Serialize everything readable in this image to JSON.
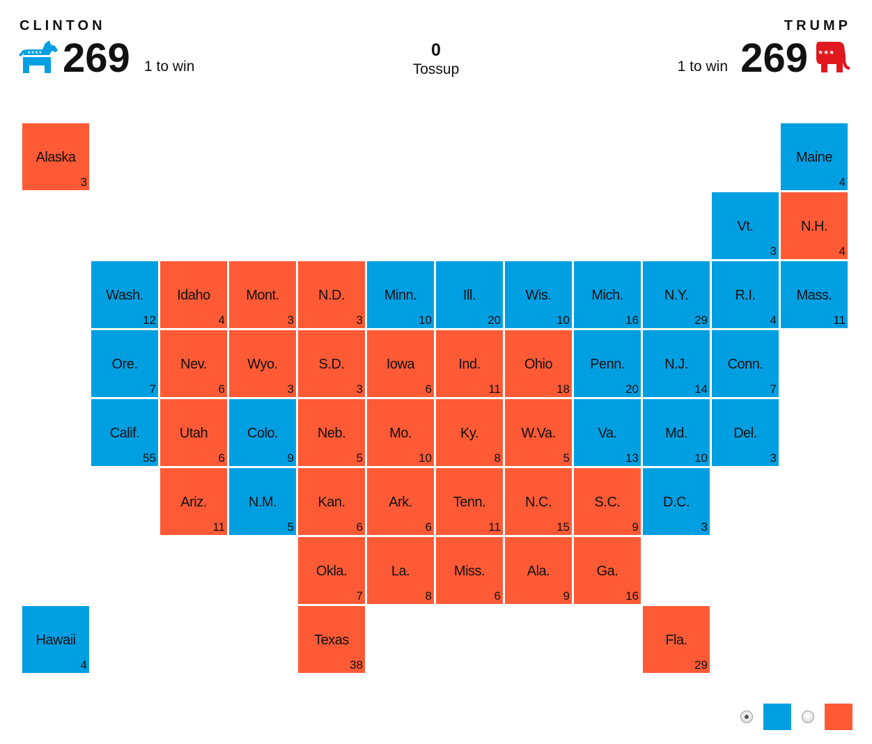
{
  "header": {
    "left": {
      "name": "CLINTON",
      "score": "269",
      "to_win": "1 to win",
      "icon": "democrat-donkey-icon"
    },
    "right": {
      "name": "TRUMP",
      "score": "269",
      "to_win": "1 to win",
      "icon": "republican-elephant-icon"
    },
    "tossup": {
      "count": "0",
      "label": "Tossup"
    }
  },
  "colors": {
    "dem": "#009fe2",
    "rep": "#ff5a36",
    "text": "#111111"
  },
  "legend": {
    "items": [
      {
        "party": "dem",
        "selected": true
      },
      {
        "party": "rep",
        "selected": false
      }
    ]
  },
  "states": [
    {
      "name": "Alaska",
      "ev": "3",
      "party": "rep",
      "col": 0,
      "row": 0
    },
    {
      "name": "Maine",
      "ev": "4",
      "party": "dem",
      "col": 11,
      "row": 0
    },
    {
      "name": "Vt.",
      "ev": "3",
      "party": "dem",
      "col": 10,
      "row": 1
    },
    {
      "name": "N.H.",
      "ev": "4",
      "party": "rep",
      "col": 11,
      "row": 1
    },
    {
      "name": "Wash.",
      "ev": "12",
      "party": "dem",
      "col": 1,
      "row": 2
    },
    {
      "name": "Idaho",
      "ev": "4",
      "party": "rep",
      "col": 2,
      "row": 2
    },
    {
      "name": "Mont.",
      "ev": "3",
      "party": "rep",
      "col": 3,
      "row": 2
    },
    {
      "name": "N.D.",
      "ev": "3",
      "party": "rep",
      "col": 4,
      "row": 2
    },
    {
      "name": "Minn.",
      "ev": "10",
      "party": "dem",
      "col": 5,
      "row": 2
    },
    {
      "name": "Ill.",
      "ev": "20",
      "party": "dem",
      "col": 6,
      "row": 2
    },
    {
      "name": "Wis.",
      "ev": "10",
      "party": "dem",
      "col": 7,
      "row": 2
    },
    {
      "name": "Mich.",
      "ev": "16",
      "party": "dem",
      "col": 8,
      "row": 2
    },
    {
      "name": "N.Y.",
      "ev": "29",
      "party": "dem",
      "col": 9,
      "row": 2
    },
    {
      "name": "R.I.",
      "ev": "4",
      "party": "dem",
      "col": 10,
      "row": 2
    },
    {
      "name": "Mass.",
      "ev": "11",
      "party": "dem",
      "col": 11,
      "row": 2
    },
    {
      "name": "Ore.",
      "ev": "7",
      "party": "dem",
      "col": 1,
      "row": 3
    },
    {
      "name": "Nev.",
      "ev": "6",
      "party": "rep",
      "col": 2,
      "row": 3
    },
    {
      "name": "Wyo.",
      "ev": "3",
      "party": "rep",
      "col": 3,
      "row": 3
    },
    {
      "name": "S.D.",
      "ev": "3",
      "party": "rep",
      "col": 4,
      "row": 3
    },
    {
      "name": "Iowa",
      "ev": "6",
      "party": "rep",
      "col": 5,
      "row": 3
    },
    {
      "name": "Ind.",
      "ev": "11",
      "party": "rep",
      "col": 6,
      "row": 3
    },
    {
      "name": "Ohio",
      "ev": "18",
      "party": "rep",
      "col": 7,
      "row": 3
    },
    {
      "name": "Penn.",
      "ev": "20",
      "party": "dem",
      "col": 8,
      "row": 3
    },
    {
      "name": "N.J.",
      "ev": "14",
      "party": "dem",
      "col": 9,
      "row": 3
    },
    {
      "name": "Conn.",
      "ev": "7",
      "party": "dem",
      "col": 10,
      "row": 3
    },
    {
      "name": "Calif.",
      "ev": "55",
      "party": "dem",
      "col": 1,
      "row": 4
    },
    {
      "name": "Utah",
      "ev": "6",
      "party": "rep",
      "col": 2,
      "row": 4
    },
    {
      "name": "Colo.",
      "ev": "9",
      "party": "dem",
      "col": 3,
      "row": 4
    },
    {
      "name": "Neb.",
      "ev": "5",
      "party": "rep",
      "col": 4,
      "row": 4
    },
    {
      "name": "Mo.",
      "ev": "10",
      "party": "rep",
      "col": 5,
      "row": 4
    },
    {
      "name": "Ky.",
      "ev": "8",
      "party": "rep",
      "col": 6,
      "row": 4
    },
    {
      "name": "W.Va.",
      "ev": "5",
      "party": "rep",
      "col": 7,
      "row": 4
    },
    {
      "name": "Va.",
      "ev": "13",
      "party": "dem",
      "col": 8,
      "row": 4
    },
    {
      "name": "Md.",
      "ev": "10",
      "party": "dem",
      "col": 9,
      "row": 4
    },
    {
      "name": "Del.",
      "ev": "3",
      "party": "dem",
      "col": 10,
      "row": 4
    },
    {
      "name": "Ariz.",
      "ev": "11",
      "party": "rep",
      "col": 2,
      "row": 5
    },
    {
      "name": "N.M.",
      "ev": "5",
      "party": "dem",
      "col": 3,
      "row": 5
    },
    {
      "name": "Kan.",
      "ev": "6",
      "party": "rep",
      "col": 4,
      "row": 5
    },
    {
      "name": "Ark.",
      "ev": "6",
      "party": "rep",
      "col": 5,
      "row": 5
    },
    {
      "name": "Tenn.",
      "ev": "11",
      "party": "rep",
      "col": 6,
      "row": 5
    },
    {
      "name": "N.C.",
      "ev": "15",
      "party": "rep",
      "col": 7,
      "row": 5
    },
    {
      "name": "S.C.",
      "ev": "9",
      "party": "rep",
      "col": 8,
      "row": 5
    },
    {
      "name": "D.C.",
      "ev": "3",
      "party": "dem",
      "col": 9,
      "row": 5
    },
    {
      "name": "Okla.",
      "ev": "7",
      "party": "rep",
      "col": 4,
      "row": 6
    },
    {
      "name": "La.",
      "ev": "8",
      "party": "rep",
      "col": 5,
      "row": 6
    },
    {
      "name": "Miss.",
      "ev": "6",
      "party": "rep",
      "col": 6,
      "row": 6
    },
    {
      "name": "Ala.",
      "ev": "9",
      "party": "rep",
      "col": 7,
      "row": 6
    },
    {
      "name": "Ga.",
      "ev": "16",
      "party": "rep",
      "col": 8,
      "row": 6
    },
    {
      "name": "Hawaii",
      "ev": "4",
      "party": "dem",
      "col": 0,
      "row": 7
    },
    {
      "name": "Texas",
      "ev": "38",
      "party": "rep",
      "col": 4,
      "row": 7
    },
    {
      "name": "Fla.",
      "ev": "29",
      "party": "rep",
      "col": 9,
      "row": 7
    }
  ]
}
